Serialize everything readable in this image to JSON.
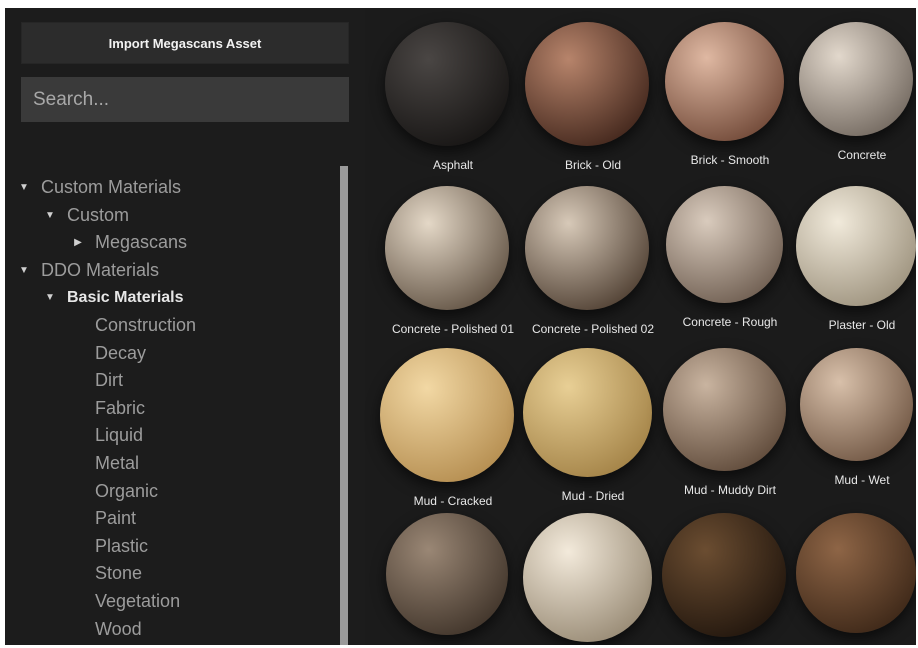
{
  "import_button": {
    "label": "Import Megascans Asset"
  },
  "search": {
    "placeholder": "Search..."
  },
  "tree": [
    {
      "label": "Custom Materials",
      "level": 0,
      "arrow": "expanded"
    },
    {
      "label": "Custom",
      "level": 1,
      "arrow": "expanded"
    },
    {
      "label": "Megascans",
      "level": 2,
      "arrow": "collapsed"
    },
    {
      "label": "DDO Materials",
      "level": 0,
      "arrow": "expanded"
    },
    {
      "label": "Basic Materials",
      "level": 1,
      "arrow": "expanded",
      "selected": true
    },
    {
      "label": "Construction",
      "level": 2
    },
    {
      "label": "Decay",
      "level": 2
    },
    {
      "label": "Dirt",
      "level": 2
    },
    {
      "label": "Fabric",
      "level": 2
    },
    {
      "label": "Liquid",
      "level": 2
    },
    {
      "label": "Metal",
      "level": 2
    },
    {
      "label": "Organic",
      "level": 2
    },
    {
      "label": "Paint",
      "level": 2
    },
    {
      "label": "Plastic",
      "level": 2
    },
    {
      "label": "Stone",
      "level": 2
    },
    {
      "label": "Vegetation",
      "level": 2
    },
    {
      "label": "Wood",
      "level": 2
    }
  ],
  "materials": [
    {
      "label": "Asphalt",
      "color_light": "#4a4644",
      "color_dark": "#151312"
    },
    {
      "label": "Brick - Old",
      "color_light": "#b7846b",
      "color_dark": "#3e2319"
    },
    {
      "label": "Brick - Smooth",
      "color_light": "#dfb8a2",
      "color_dark": "#6d4534"
    },
    {
      "label": "Concrete",
      "color_light": "#e2d8cc",
      "color_dark": "#6f655c"
    },
    {
      "label": "Concrete - Polished 01",
      "color_light": "#e4d8c7",
      "color_dark": "#5e4f40"
    },
    {
      "label": "Concrete - Polished 02",
      "color_light": "#d7c9b8",
      "color_dark": "#4b3b2e"
    },
    {
      "label": "Concrete - Rough",
      "color_light": "#d9cbbd",
      "color_dark": "#6b5a4d"
    },
    {
      "label": "Plaster - Old",
      "color_light": "#f1eadb",
      "color_dark": "#9a8f7a"
    },
    {
      "label": "Mud - Cracked",
      "color_light": "#f2d8a4",
      "color_dark": "#b28a4c"
    },
    {
      "label": "Mud - Dried",
      "color_light": "#e8cf95",
      "color_dark": "#a07f43"
    },
    {
      "label": "Mud - Muddy Dirt",
      "color_light": "#c9b4a0",
      "color_dark": "#5b4636"
    },
    {
      "label": "Mud - Wet",
      "color_light": "#d8c0aa",
      "color_dark": "#6e5441"
    },
    {
      "label": "",
      "color_light": "#9a8775",
      "color_dark": "#3d3127"
    },
    {
      "label": "",
      "color_light": "#f3eadb",
      "color_dark": "#948670"
    },
    {
      "label": "",
      "color_light": "#6b4d31",
      "color_dark": "#1f140c"
    },
    {
      "label": "",
      "color_light": "#8e6546",
      "color_dark": "#3a2516"
    }
  ]
}
